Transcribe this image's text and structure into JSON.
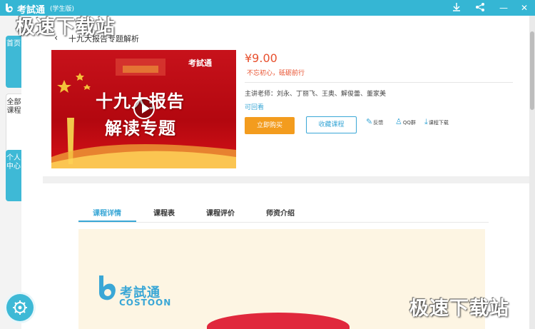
{
  "titlebar": {
    "app_name": "考試通",
    "app_edition": "(学生版)",
    "download_icon": "download-icon",
    "share_icon": "share-icon",
    "minimize_label": "—",
    "close_label": "✕",
    "bg_color": "#35b6d4"
  },
  "watermark": {
    "top_left": "极速下载站",
    "bottom_right": "极速下载站"
  },
  "sidebar": {
    "tabs": [
      {
        "label": "首页",
        "active": false
      },
      {
        "label": "全部课程",
        "active": true
      },
      {
        "label": "个人中心",
        "active": false
      }
    ],
    "settings_icon": "gear-icon"
  },
  "course": {
    "back_label": "‹",
    "title": "十九大报告专题解析",
    "cover": {
      "brand": "考試通",
      "title_line1": "十九大报告",
      "title_line2": "解读专题"
    },
    "price": "¥9.00",
    "slogan": "不忘初心，砥砺前行",
    "teachers": "主讲老师：刘永、丁丽飞、王奥、解俊蕾、董家美",
    "replay_label": "可回看",
    "buy_label": "立即购买",
    "favorite_label": "收藏课程",
    "actions": [
      {
        "icon": "pencil-icon",
        "label": "反馈"
      },
      {
        "icon": "qq-icon",
        "label": "QQ群"
      },
      {
        "icon": "download-icon",
        "label": "课程下载"
      }
    ],
    "accent_color": "#3aa7d6",
    "price_color": "#e8502e",
    "buy_color": "#f39c1e"
  },
  "detail_tabs": [
    {
      "label": "课程详情",
      "active": true
    },
    {
      "label": "课程表",
      "active": false
    },
    {
      "label": "课程评价",
      "active": false
    },
    {
      "label": "师资介绍",
      "active": false
    }
  ],
  "detail_content": {
    "brand_cn": "考試通",
    "brand_en": "COSTOON"
  }
}
